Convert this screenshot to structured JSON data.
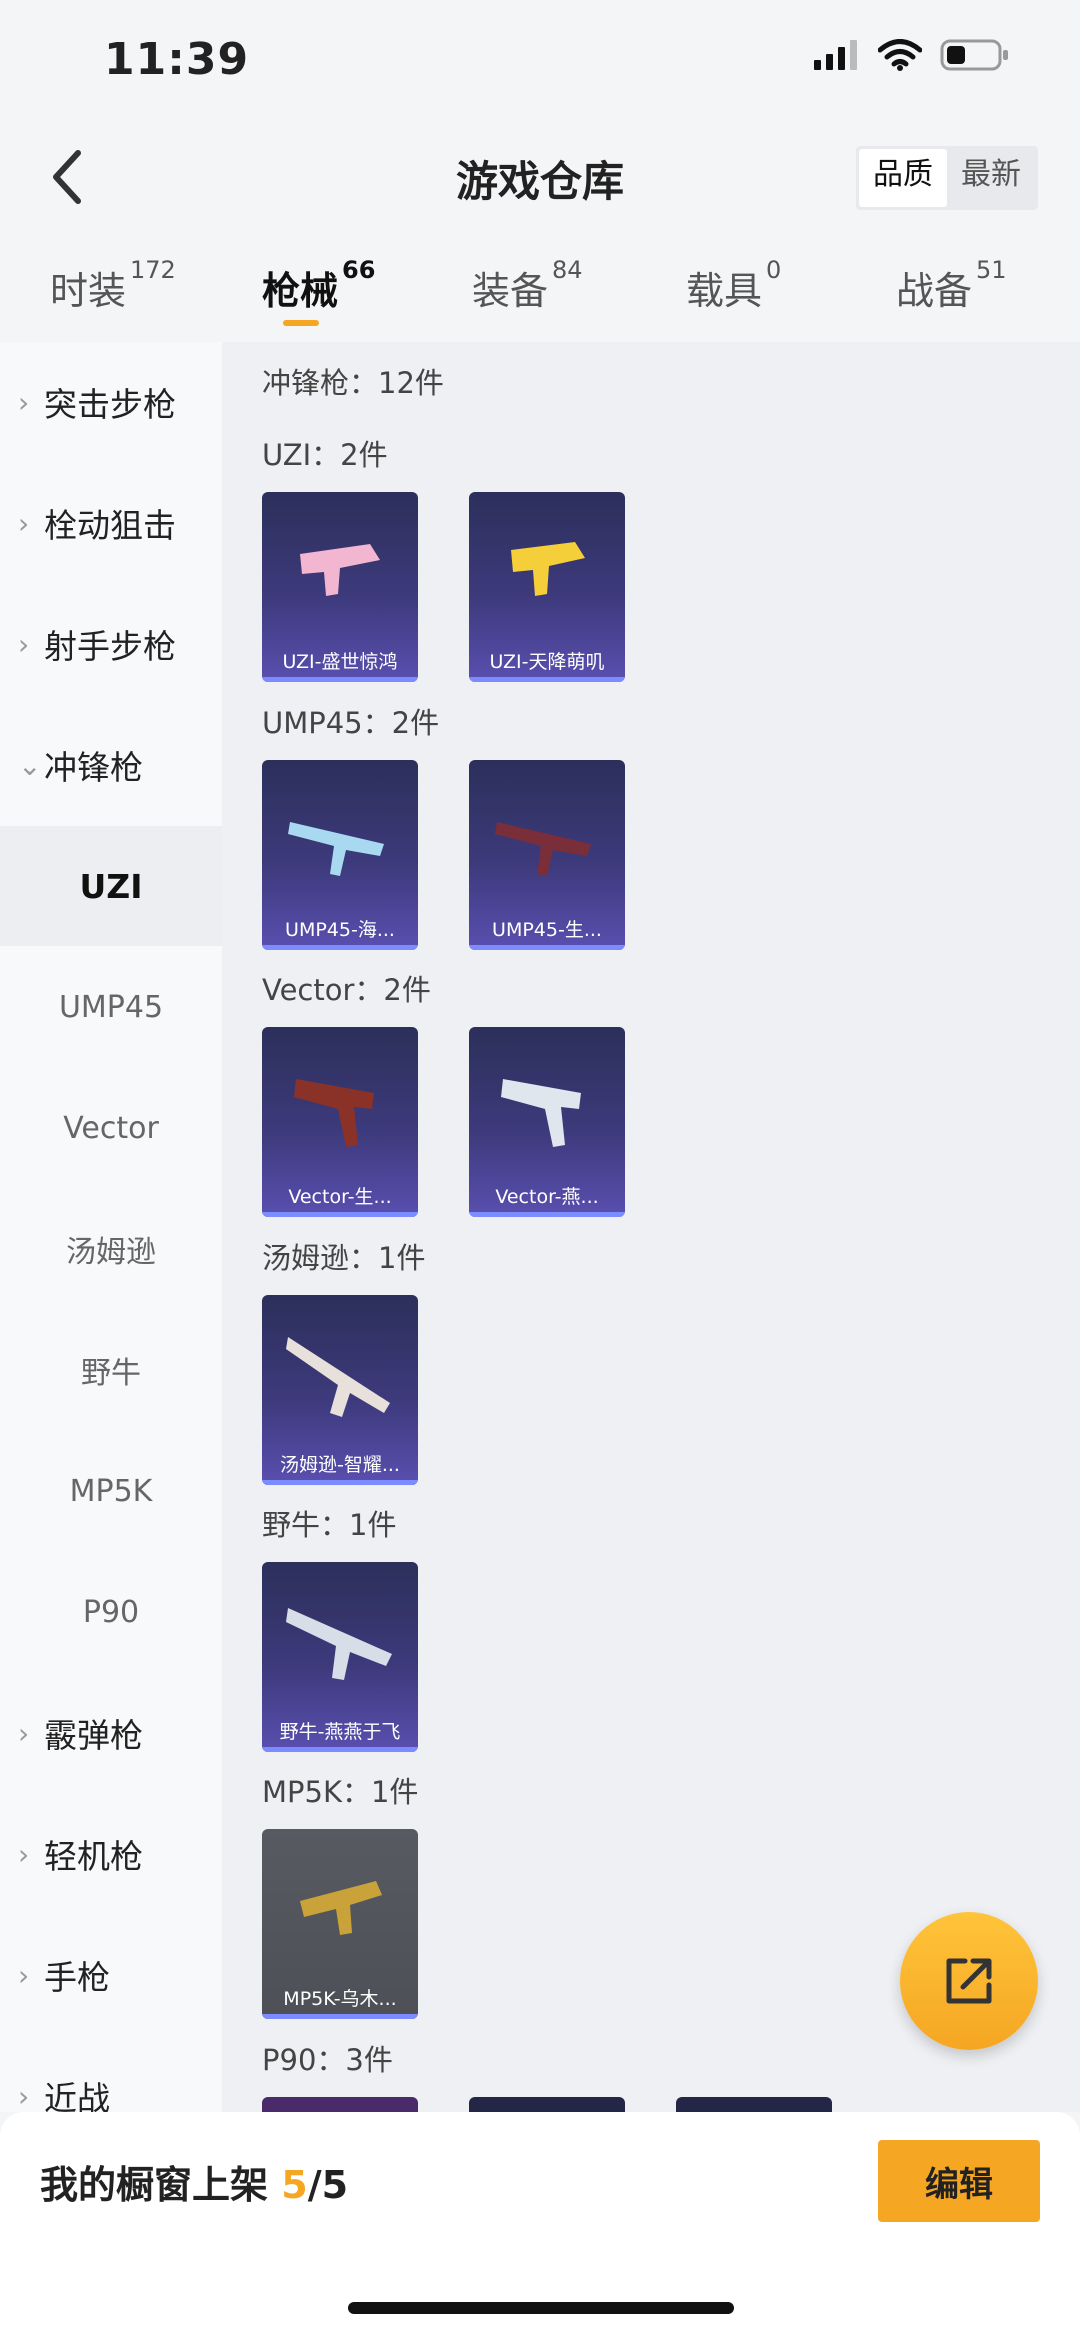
{
  "status": {
    "time": "11:39"
  },
  "header": {
    "title": "游戏仓库",
    "sort_quality": "品质",
    "sort_newest": "最新"
  },
  "tabs": [
    {
      "label": "时装",
      "count": "172"
    },
    {
      "label": "枪械",
      "count": "66"
    },
    {
      "label": "装备",
      "count": "84"
    },
    {
      "label": "载具",
      "count": "0"
    },
    {
      "label": "战备",
      "count": "51"
    }
  ],
  "sidebar": {
    "categories": [
      "突击步枪",
      "栓动狙击",
      "射手步枪",
      "冲锋枪",
      "霰弹枪",
      "轻机枪",
      "手枪",
      "近战"
    ],
    "subitems": [
      "UZI",
      "UMP45",
      "Vector",
      "汤姆逊",
      "野牛",
      "MP5K",
      "P90"
    ]
  },
  "content": {
    "total": "冲锋枪：12件",
    "sections": [
      {
        "title": "UZI：2件",
        "items": [
          "UZI-盛世惊鸿",
          "UZI-天降萌叽"
        ]
      },
      {
        "title": "UMP45：2件",
        "items": [
          "UMP45-海...",
          "UMP45-生..."
        ]
      },
      {
        "title": "Vector：2件",
        "items": [
          "Vector-生...",
          "Vector-燕..."
        ]
      },
      {
        "title": "汤姆逊：1件",
        "items": [
          "汤姆逊-智耀..."
        ]
      },
      {
        "title": "野牛：1件",
        "items": [
          "野牛-燕燕于飞"
        ]
      },
      {
        "title": "MP5K：1件",
        "items": [
          "MP5K-乌木..."
        ]
      },
      {
        "title": "P90：3件",
        "items": []
      }
    ]
  },
  "bottom": {
    "showcase_label": "我的橱窗上架",
    "count_current": "5",
    "count_total": "/5",
    "edit": "编辑"
  },
  "colors": {
    "accent": "#f5a623",
    "card": "#3d3a7c"
  }
}
